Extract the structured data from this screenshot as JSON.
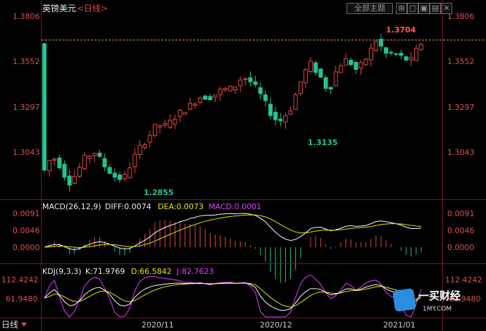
{
  "header": {
    "title": "英镑美元",
    "period_label": "<日线>",
    "theme_button": "全部主题",
    "ctrl_icons": [
      "⊞",
      "▢",
      "▣",
      "▤",
      "✕"
    ]
  },
  "price_axis": {
    "ticks": [
      "1.3806",
      "1.3552",
      "1.3297",
      "1.3043"
    ]
  },
  "annotations": {
    "high": "1.3704",
    "low_left": "1.2855",
    "low_mid": "1.3135"
  },
  "macd": {
    "title": "MACD(26,12,9)",
    "diff_label": "DIFF:0.0074",
    "dea_label": "DEA:0.0073",
    "macd_label": "MACD:0.0001",
    "ticks": [
      "0.0091",
      "0.0046",
      "0.0000"
    ]
  },
  "kdj": {
    "title": "KDJ(9,3,3)",
    "k_label": "K:71.9769",
    "d_label": "D:66.5842",
    "j_label": "J:82.7623",
    "ticks": [
      "112.4242",
      "61.9480"
    ]
  },
  "date_axis": {
    "corner": "日线",
    "dates": [
      "2020/11",
      "2020/12",
      "2021/01"
    ]
  },
  "watermark": {
    "brand": "一买财经",
    "url": "1MY.COM"
  },
  "chart_data": {
    "type": "candlestick",
    "price_range": [
      1.278,
      1.39
    ],
    "reference_line": 1.37,
    "colors": {
      "up": "#e04848",
      "down": "#21c493",
      "diff": "#ffffff",
      "dea": "#e6e600",
      "k": "#ffffff",
      "d": "#e6e600",
      "j": "#e040fb"
    }
  }
}
